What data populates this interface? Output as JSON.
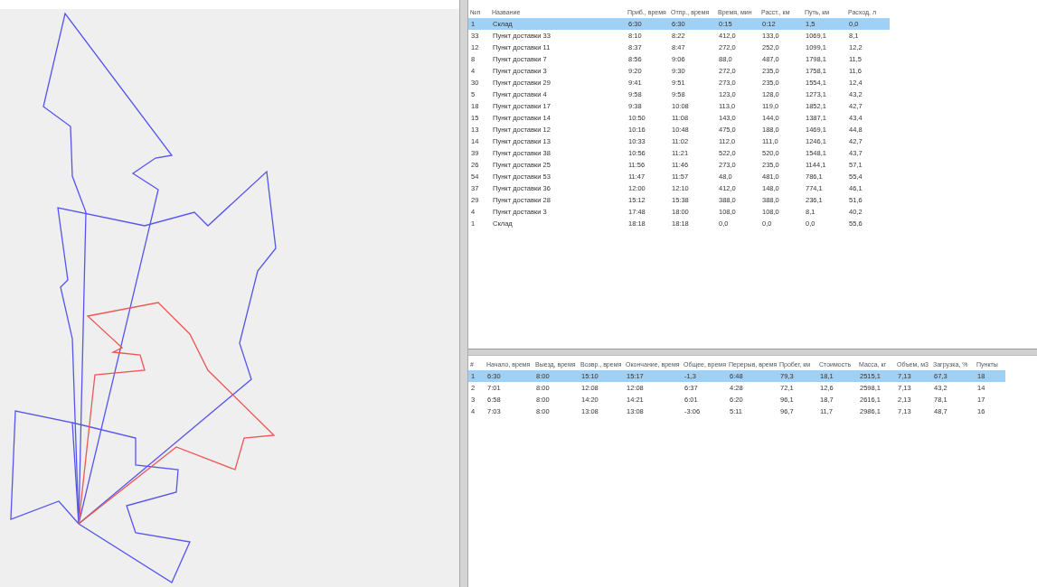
{
  "map": {
    "routes": [
      {
        "color": "#5555ee"
      },
      {
        "color": "#5555ee"
      },
      {
        "color": "#5555ee"
      },
      {
        "color": "#ee5555"
      }
    ]
  },
  "top_table": {
    "columns": [
      "№п",
      "Название",
      "Приб., время",
      "Отпр., время",
      "Время, мин",
      "Расст., км",
      "Путь, км",
      "Расход, л"
    ],
    "rows": [
      {
        "cells": [
          "1",
          "Склад",
          "6:30",
          "6:30",
          "0:15",
          "0:12",
          "1,5",
          "0,0"
        ],
        "selected": true
      },
      {
        "cells": [
          "33",
          "Пункт доставки 33",
          "8:10",
          "8:22",
          "412,0",
          "133,0",
          "1069,1",
          "8,1"
        ],
        "selected": false
      },
      {
        "cells": [
          "12",
          "Пункт доставки 11",
          "8:37",
          "8:47",
          "272,0",
          "252,0",
          "1099,1",
          "12,2"
        ],
        "selected": false
      },
      {
        "cells": [
          "8",
          "Пункт доставки 7",
          "8:56",
          "9:06",
          "88,0",
          "487,0",
          "1798,1",
          "11,5"
        ],
        "selected": false
      },
      {
        "cells": [
          "4",
          "Пункт доставки 3",
          "9:20",
          "9:30",
          "272,0",
          "235,0",
          "1758,1",
          "11,6"
        ],
        "selected": false
      },
      {
        "cells": [
          "30",
          "Пункт доставки 29",
          "9:41",
          "9:51",
          "273,0",
          "235,0",
          "1554,1",
          "12,4"
        ],
        "selected": false
      },
      {
        "cells": [
          "5",
          "Пункт доставки 4",
          "9:58",
          "9:58",
          "123,0",
          "128,0",
          "1273,1",
          "43,2"
        ],
        "selected": false
      },
      {
        "cells": [
          "18",
          "Пункт доставки 17",
          "9:38",
          "10:08",
          "113,0",
          "119,0",
          "1852,1",
          "42,7"
        ],
        "selected": false
      },
      {
        "cells": [
          "15",
          "Пункт доставки 14",
          "10:50",
          "11:08",
          "143,0",
          "144,0",
          "1387,1",
          "43,4"
        ],
        "selected": false
      },
      {
        "cells": [
          "13",
          "Пункт доставки 12",
          "10:16",
          "10:48",
          "475,0",
          "188,0",
          "1469,1",
          "44,8"
        ],
        "selected": false
      },
      {
        "cells": [
          "14",
          "Пункт доставки 13",
          "10:33",
          "11:02",
          "112,0",
          "111,0",
          "1246,1",
          "42,7"
        ],
        "selected": false
      },
      {
        "cells": [
          "39",
          "Пункт доставки 38",
          "10:56",
          "11:21",
          "522,0",
          "520,0",
          "1548,1",
          "43,7"
        ],
        "selected": false
      },
      {
        "cells": [
          "26",
          "Пункт доставки 25",
          "11:56",
          "11:46",
          "273,0",
          "235,0",
          "1144,1",
          "57,1"
        ],
        "selected": false
      },
      {
        "cells": [
          "54",
          "Пункт доставки 53",
          "11:47",
          "11:57",
          "48,0",
          "481,0",
          "786,1",
          "55,4"
        ],
        "selected": false
      },
      {
        "cells": [
          "37",
          "Пункт доставки 36",
          "12:00",
          "12:10",
          "412,0",
          "148,0",
          "774,1",
          "46,1"
        ],
        "selected": false
      },
      {
        "cells": [
          "29",
          "Пункт доставки 28",
          "15:12",
          "15:38",
          "388,0",
          "388,0",
          "236,1",
          "51,6"
        ],
        "selected": false
      },
      {
        "cells": [
          "4",
          "Пункт доставки 3",
          "17:48",
          "18:00",
          "108,0",
          "108,0",
          "8,1",
          "40,2"
        ],
        "selected": false
      },
      {
        "cells": [
          "1",
          "Склад",
          "18:18",
          "18:18",
          "0,0",
          "0,0",
          "0,0",
          "55,6"
        ],
        "selected": false
      }
    ]
  },
  "bottom_table": {
    "columns": [
      "#",
      "Начало, время",
      "Выезд, время",
      "Возвр., время",
      "Окончание, время",
      "Общее, время",
      "Перерыв, время",
      "Пробег, км",
      "Стоимость",
      "Масса, кг",
      "Объем, м3",
      "Загрузка, %",
      "Пункты"
    ],
    "rows": [
      {
        "cells": [
          "1",
          "6:30",
          "8:00",
          "15:10",
          "15:17",
          "-1,3",
          "6:48",
          "79,3",
          "18,1",
          "2515,1",
          "7,13",
          "67,3",
          "18"
        ],
        "selected": true
      },
      {
        "cells": [
          "2",
          "7:01",
          "8:00",
          "12:08",
          "12:08",
          "6:37",
          "4:28",
          "72,1",
          "12,6",
          "2598,1",
          "7,13",
          "43,2",
          "14"
        ],
        "selected": false
      },
      {
        "cells": [
          "3",
          "6:58",
          "8:00",
          "14:20",
          "14:21",
          "6:01",
          "6:20",
          "96,1",
          "18,7",
          "2616,1",
          "2,13",
          "78,1",
          "17"
        ],
        "selected": false
      },
      {
        "cells": [
          "4",
          "7:03",
          "8:00",
          "13:08",
          "13:08",
          "-3:06",
          "5:11",
          "96,7",
          "11,7",
          "2986,1",
          "7,13",
          "48,7",
          "16"
        ],
        "selected": false
      }
    ]
  }
}
